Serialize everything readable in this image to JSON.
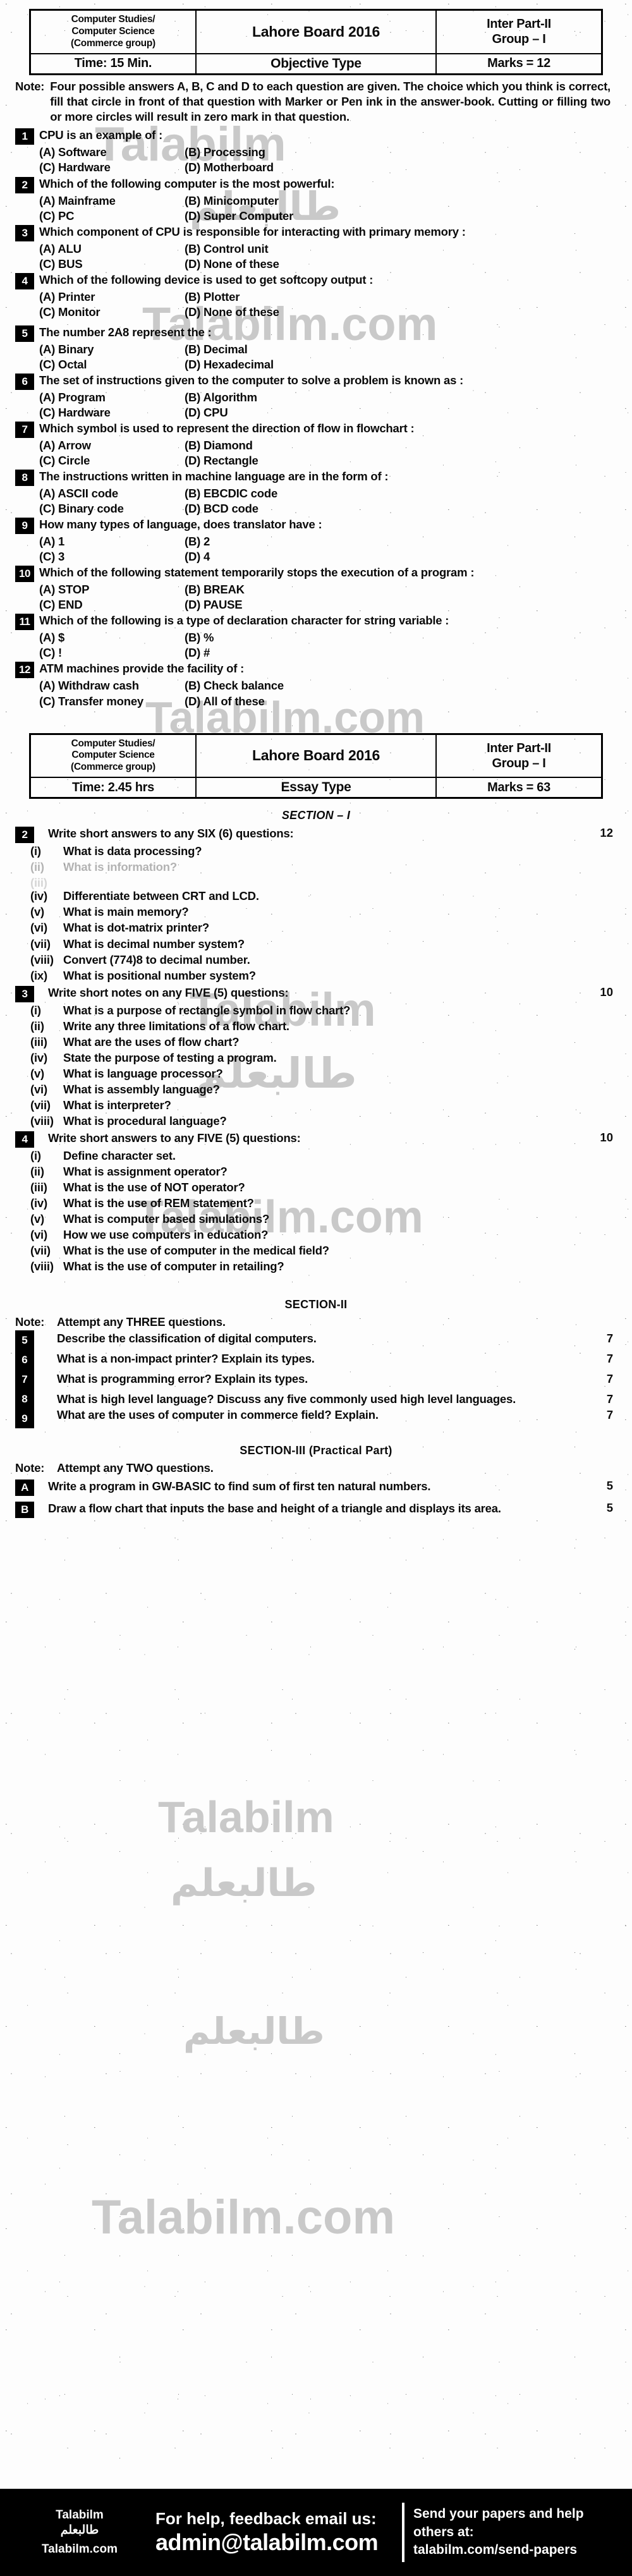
{
  "header_objective": {
    "subject": "Computer Studies/ Computer Science (Commerce group)",
    "subject_line1": "Computer Studies/",
    "subject_line2": "Computer Science",
    "subject_line3": "(Commerce group)",
    "board": "Lahore Board 2016",
    "part_line1": "Inter Part-II",
    "part_line2": "Group – I",
    "time": "Time: 15 Min.",
    "paper_type": "Objective Type",
    "marks": "Marks = 12"
  },
  "objective_note": {
    "label": "Note:",
    "text": "Four possible answers A, B, C and D to each question are given. The choice which you think is correct, fill that circle in front of that question with Marker or Pen ink in the answer-book. Cutting or filling two or more circles will result in zero mark in that question."
  },
  "mcqs": [
    {
      "num": "1",
      "text": "CPU is an example of :",
      "options": [
        "(A) Software",
        "(B) Processing",
        "(C) Hardware",
        "(D) Motherboard"
      ]
    },
    {
      "num": "2",
      "text": "Which of the following computer is the most powerful:",
      "options": [
        "(A) Mainframe",
        "(B) Minicomputer",
        "(C) PC",
        "(D) Super Computer"
      ]
    },
    {
      "num": "3",
      "text": "Which component of CPU is responsible for interacting with primary memory :",
      "options": [
        "(A) ALU",
        "(B) Control unit",
        "(C) BUS",
        "(D) None of these"
      ]
    },
    {
      "num": "4",
      "text": "Which of the following device is used to get softcopy output :",
      "options": [
        "(A) Printer",
        "(B) Plotter",
        "(C) Monitor",
        "(D) None of these"
      ]
    },
    {
      "num": "5",
      "text": "The number 2A8 represent the :",
      "options": [
        "(A) Binary",
        "(B) Decimal",
        "(C) Octal",
        "(D) Hexadecimal"
      ]
    },
    {
      "num": "6",
      "text": "The set of instructions given to the computer to solve a problem is known as :",
      "options": [
        "(A) Program",
        "(B) Algorithm",
        "(C) Hardware",
        "(D) CPU"
      ]
    },
    {
      "num": "7",
      "text": "Which symbol is used to represent the direction of flow in flowchart :",
      "options": [
        "(A) Arrow",
        "(B) Diamond",
        "(C) Circle",
        "(D) Rectangle"
      ]
    },
    {
      "num": "8",
      "text": "The instructions written in machine language are in the form of :",
      "options": [
        "(A) ASCII code",
        "(B) EBCDIC code",
        "(C) Binary code",
        "(D) BCD code"
      ]
    },
    {
      "num": "9",
      "text": "How many types of language, does translator have :",
      "options": [
        "(A) 1",
        "(B) 2",
        "(C) 3",
        "(D) 4"
      ]
    },
    {
      "num": "10",
      "text": "Which of the following statement temporarily stops the execution of a program :",
      "options": [
        "(A) STOP",
        "(B) BREAK",
        "(C) END",
        "(D) PAUSE"
      ]
    },
    {
      "num": "11",
      "text": "Which of the following is a type of declaration character for string variable :",
      "options": [
        "(A) $",
        "(B) %",
        "(C) !",
        "(D) #"
      ]
    },
    {
      "num": "12",
      "text": "ATM machines provide the facility of :",
      "options": [
        "(A) Withdraw cash",
        "(B) Check balance",
        "(C) Transfer money",
        "(D) All of these"
      ]
    }
  ],
  "header_essay": {
    "subject_line1": "Computer Studies/",
    "subject_line2": "Computer Science",
    "subject_line3": "(Commerce group)",
    "board": "Lahore Board 2016",
    "part_line1": "Inter Part-II",
    "part_line2": "Group – I",
    "time": "Time: 2.45 hrs",
    "paper_type": "Essay Type",
    "marks": "Marks = 63"
  },
  "section1": {
    "title": "SECTION – I",
    "q2": {
      "num": "2",
      "title": "Write short answers to any SIX (6) questions:",
      "marks": "12",
      "items": [
        {
          "n": "(i)",
          "t": "What is data processing?"
        },
        {
          "n": "(ii)",
          "t": "What is information?"
        },
        {
          "n": "(iii)",
          "t": ""
        },
        {
          "n": "(iv)",
          "t": "Differentiate between CRT and LCD."
        },
        {
          "n": "(v)",
          "t": "What is main memory?"
        },
        {
          "n": "(vi)",
          "t": "What is dot-matrix printer?"
        },
        {
          "n": "(vii)",
          "t": "What is decimal number system?"
        },
        {
          "n": "(viii)",
          "t": "Convert (774)8 to decimal number."
        },
        {
          "n": "(ix)",
          "t": "What is positional number system?"
        }
      ]
    },
    "q3": {
      "num": "3",
      "title": "Write short notes on any FIVE (5) questions:",
      "marks": "10",
      "items": [
        {
          "n": "(i)",
          "t": "What is a purpose of rectangle symbol in flow chart?"
        },
        {
          "n": "(ii)",
          "t": "Write any three limitations of a flow chart."
        },
        {
          "n": "(iii)",
          "t": "What are the uses of flow chart?"
        },
        {
          "n": "(iv)",
          "t": "State the purpose of testing a program."
        },
        {
          "n": "(v)",
          "t": "What is language processor?"
        },
        {
          "n": "(vi)",
          "t": "What is assembly language?"
        },
        {
          "n": "(vii)",
          "t": "What is interpreter?"
        },
        {
          "n": "(viii)",
          "t": "What is procedural language?"
        }
      ]
    },
    "q4": {
      "num": "4",
      "title": "Write short answers to any FIVE (5) questions:",
      "marks": "10",
      "items": [
        {
          "n": "(i)",
          "t": "Define character set."
        },
        {
          "n": "(ii)",
          "t": "What is assignment operator?"
        },
        {
          "n": "(iii)",
          "t": "What is the use of NOT operator?"
        },
        {
          "n": "(iv)",
          "t": "What is the use of REM statement?"
        },
        {
          "n": "(v)",
          "t": "What is computer based simulations?"
        },
        {
          "n": "(vi)",
          "t": "How we use computers in education?"
        },
        {
          "n": "(vii)",
          "t": "What is the use of computer in the medical field?"
        },
        {
          "n": "(viii)",
          "t": "What is the use of computer in retailing?"
        }
      ]
    }
  },
  "section2": {
    "title": "SECTION-II",
    "note_label": "Note:",
    "note_text": "Attempt any THREE questions.",
    "items": [
      {
        "num": "5",
        "text": "Describe the classification of digital computers.",
        "marks": "7"
      },
      {
        "num": "6",
        "text": "What is a non-impact printer? Explain its types.",
        "marks": "7"
      },
      {
        "num": "7",
        "text": "What is programming error? Explain its types.",
        "marks": "7"
      },
      {
        "num": "8",
        "text": "What is high level language? Discuss any five commonly used high level languages.",
        "marks": "7"
      },
      {
        "num": "9",
        "text": "What are the uses of computer in commerce field? Explain.",
        "marks": "7"
      }
    ]
  },
  "section3": {
    "title": "SECTION-III (Practical Part)",
    "note_label": "Note:",
    "note_text": "Attempt any TWO questions.",
    "items": [
      {
        "num": "A",
        "text": "Write a program in GW-BASIC to find sum of first ten natural numbers.",
        "marks": "5"
      },
      {
        "num": "B",
        "text": "Draw a flow chart that inputs the base and height of a triangle and displays its area.",
        "marks": "5"
      }
    ]
  },
  "footer": {
    "logo_line1": "Talabilm",
    "logo_line2": "طالبعلم",
    "logo_line3": "Talabilm.com",
    "mid_line1": "For help, feedback email us:",
    "mid_line2": "admin@talabilm.com",
    "right_line1": "Send your papers and help others at:",
    "right_line2": "talabilm.com/send-papers"
  },
  "watermarks": {
    "w1": "Talabilm",
    "w2": "Talabilm.com",
    "w3": "طالبعلم",
    "w4": "Talabilm.com",
    "w5": "Talabilm",
    "w6": "طالبعلم",
    "w7": "Talabilm.com",
    "w8": "Talabilm",
    "w9": "طالبعلم",
    "w10": "Talabilm.com"
  },
  "colors": {
    "ink": "#0a0a0a",
    "paper": "#fdfdfd",
    "watermark": "#c9c9c9",
    "footer_bg": "#000000"
  }
}
